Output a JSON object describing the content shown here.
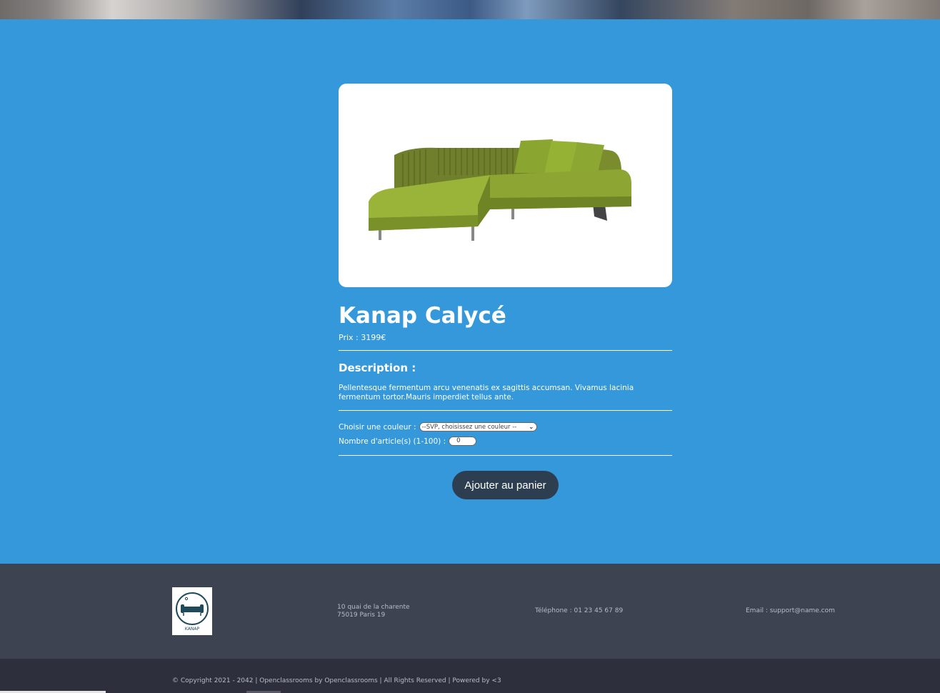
{
  "product": {
    "name": "Kanap Calycé",
    "price_label": "Prix : ",
    "price": "3199",
    "currency": "€",
    "description_heading": "Description :",
    "description": "Pellentesque fermentum arcu venenatis ex sagittis accumsan. Vivamus lacinia fermentum tortor.Mauris imperdiet tellus ante.",
    "sofa_color": "#8da532"
  },
  "form": {
    "color_label": "Choisir une couleur :",
    "color_selected": "--SVP, choisissez une couleur --",
    "quantity_label": "Nombre d'article(s) (1-100) :",
    "quantity_value": "0",
    "add_button": "Ajouter au panier"
  },
  "footer": {
    "logo_text": "KANAP",
    "address_line1": "10 quai de la charente",
    "address_line2": "75019 Paris 19",
    "phone": "Téléphone : 01 23 45 67 89",
    "email": "Email : support@name.com",
    "copyright": "© Copyright 2021 - 2042 | Openclassrooms by Openclassrooms | All Rights Reserved | Powered by <3"
  },
  "colors": {
    "main_bg": "#3498db",
    "button_bg": "#2c3e50",
    "footer_top": "#3d4350",
    "footer_bottom": "#2d2f3c"
  }
}
